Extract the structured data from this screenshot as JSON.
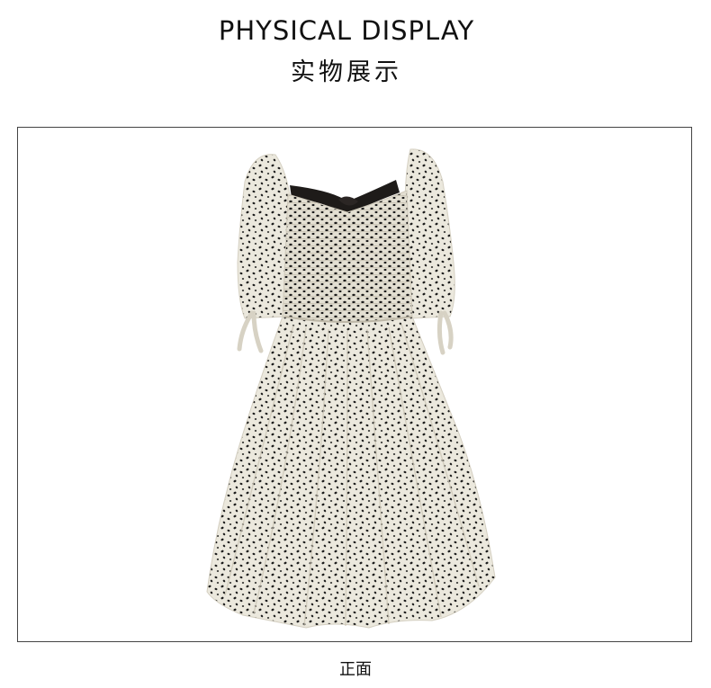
{
  "header": {
    "title_en": "PHYSICAL DISPLAY",
    "title_cn": "实物展示"
  },
  "photo": {
    "subject": "dress-front-view",
    "colors": {
      "fabric": "#ebe8dd",
      "dots": "#1a1a1a",
      "strap": "#1e1b19",
      "frame": "#444444"
    }
  },
  "caption": "正面"
}
